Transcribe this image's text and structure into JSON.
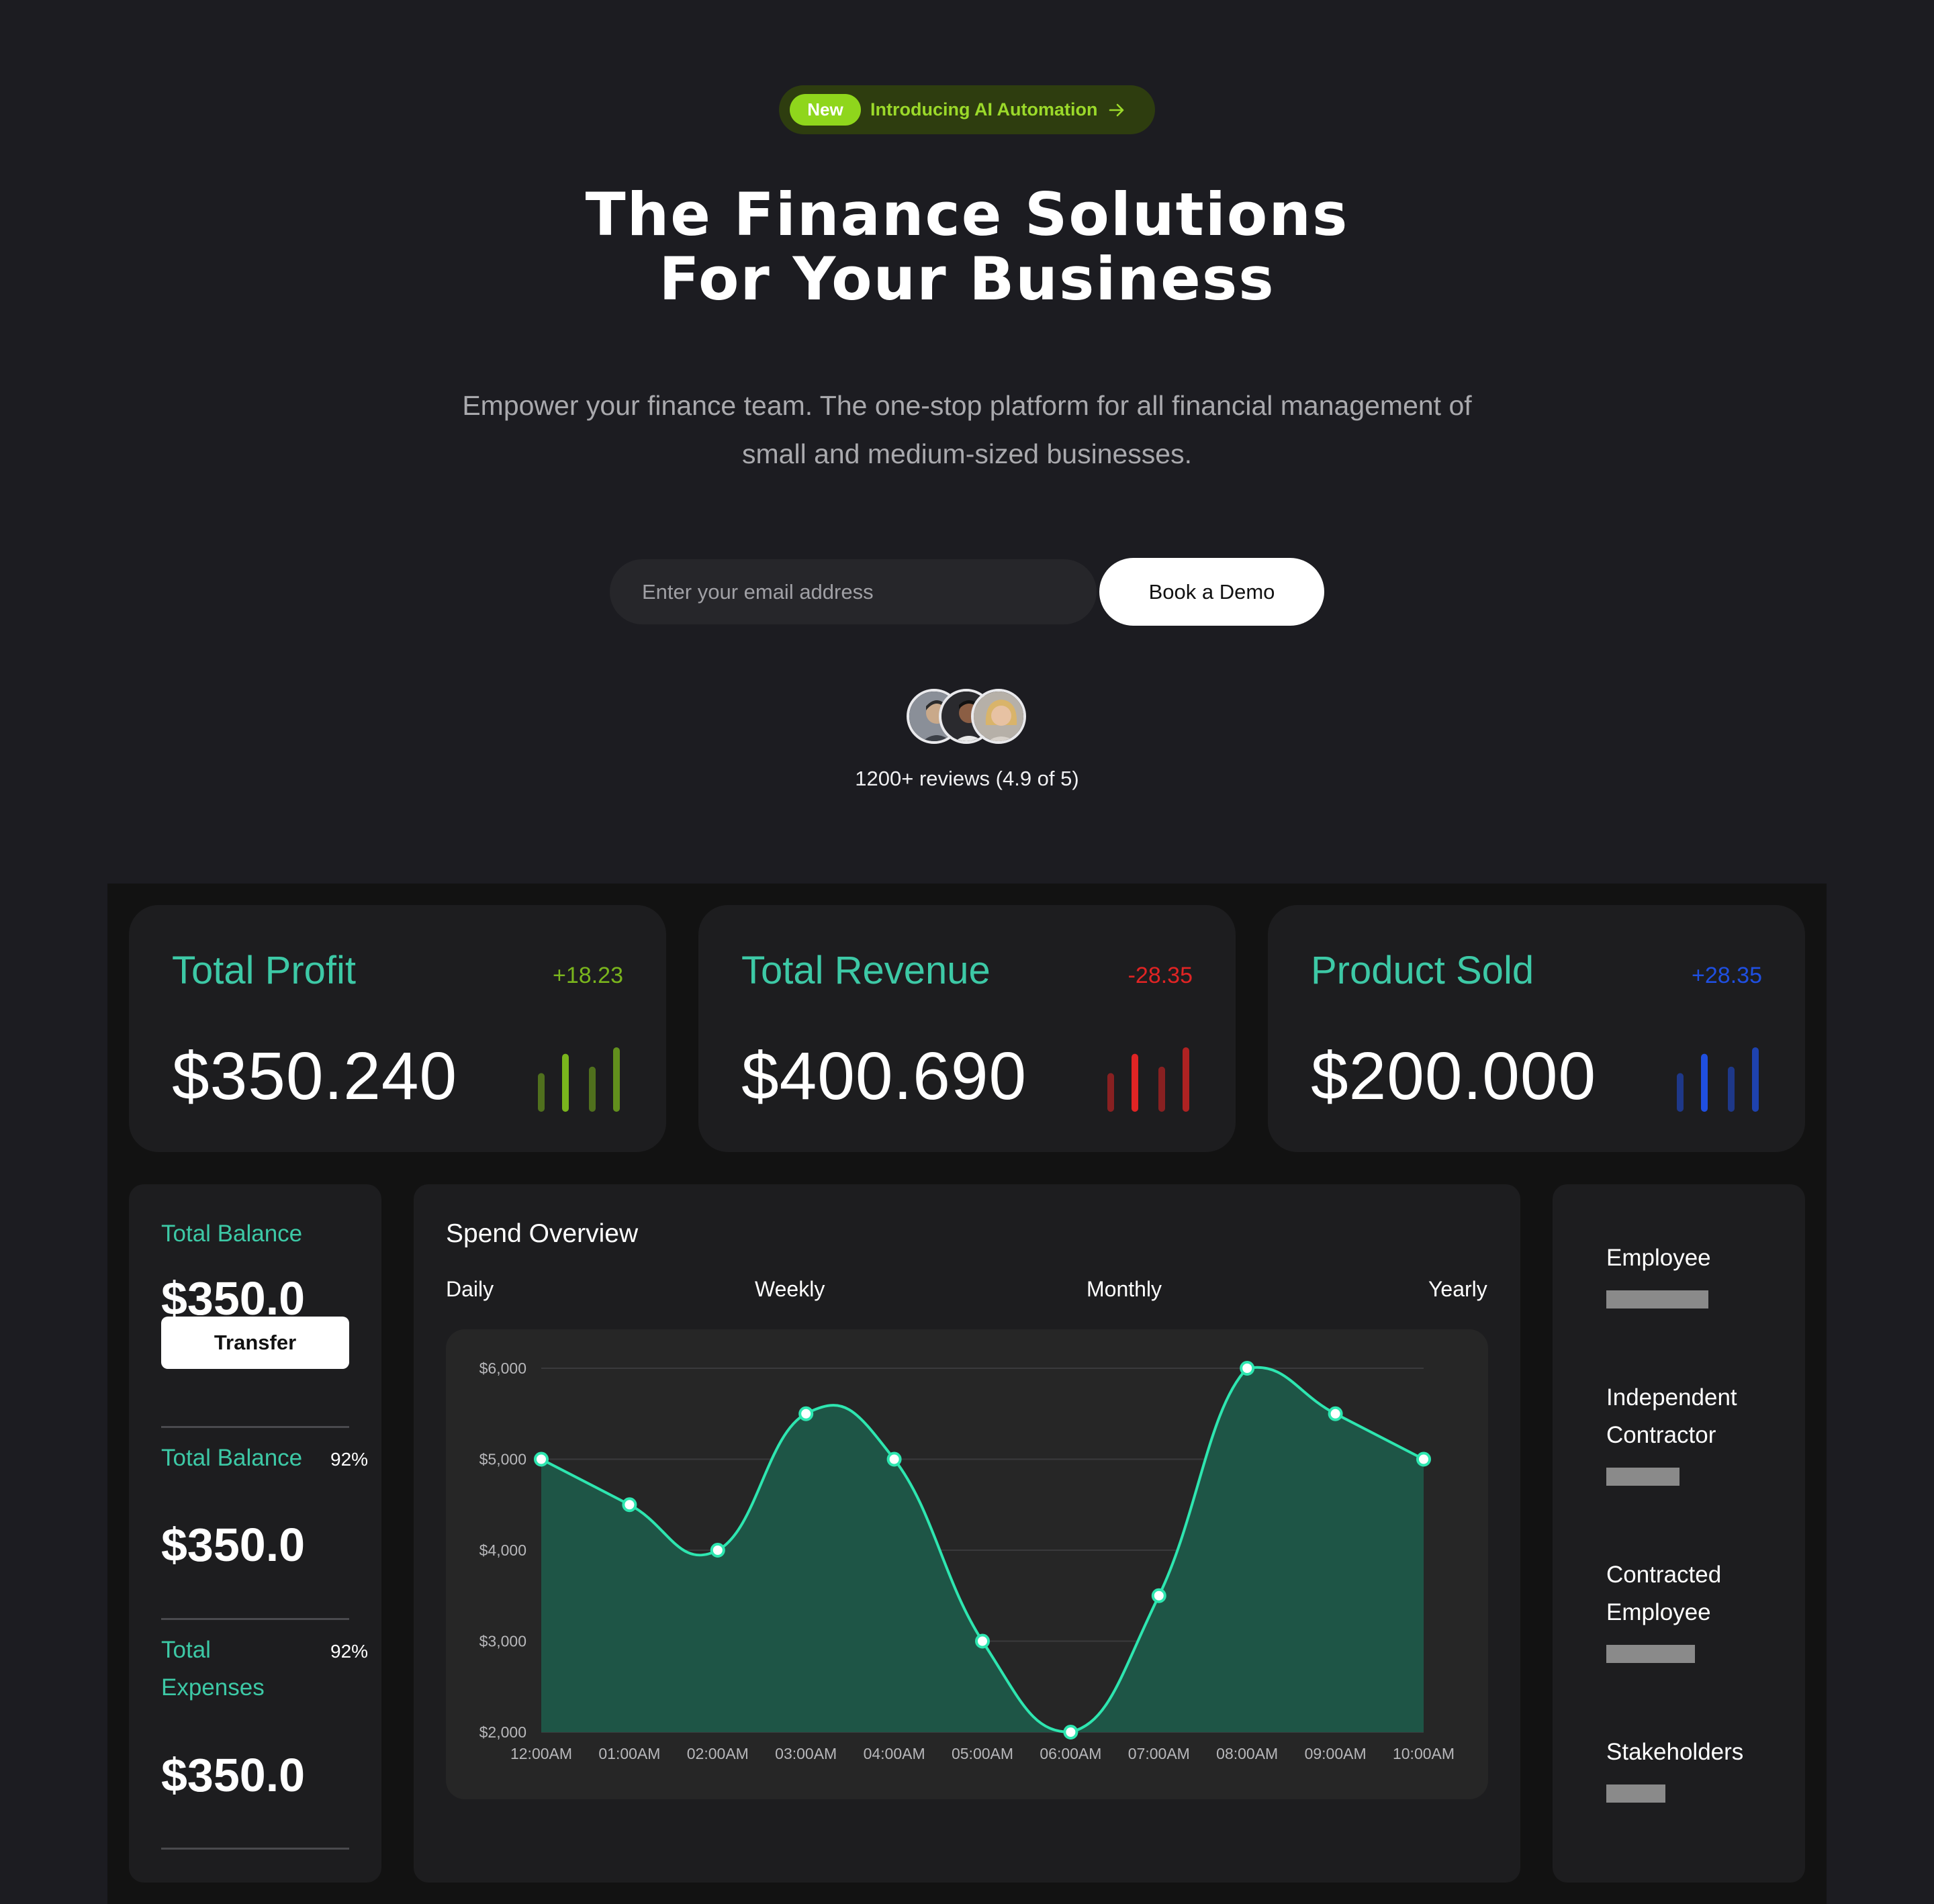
{
  "hero": {
    "badge_new": "New",
    "badge_text": "Introducing AI Automation",
    "title_line1": "The Finance Solutions",
    "title_line2": "For Your Business",
    "subtitle_line1": "Empower your finance team. The one-stop platform for all financial management of",
    "subtitle_line2": "small and medium-sized businesses.",
    "email_placeholder": "Enter your email address",
    "cta_label": "Book a Demo",
    "reviews_text": "1200+ reviews (4.9 of 5)"
  },
  "stats": [
    {
      "title": "Total Profit",
      "change": "+18.23",
      "value": "$350.240",
      "color": "#7ab51d",
      "bars": [
        0.6,
        0.9,
        0.7,
        1.0
      ]
    },
    {
      "title": "Total Revenue",
      "change": "-28.35",
      "value": "$400.690",
      "color": "#e02424",
      "bars": [
        0.6,
        0.9,
        0.7,
        1.0
      ]
    },
    {
      "title": "Product Sold",
      "change": "+28.35",
      "value": "$200.000",
      "color": "#1f4fe0",
      "bars": [
        0.6,
        0.9,
        0.7,
        1.0
      ]
    }
  ],
  "balance": {
    "label1": "Total Balance",
    "value1": "$350.0",
    "transfer_label": "Transfer",
    "label2": "Total Balance",
    "pct2": "92%",
    "value2": "$350.0",
    "label3a": "Total",
    "label3b": "Expenses",
    "pct3": "92%",
    "value3": "$350.0"
  },
  "spend": {
    "title": "Spend Overview",
    "tabs": [
      "Daily",
      "Weekly",
      "Monthly",
      "Yearly"
    ]
  },
  "chart_data": {
    "type": "area",
    "title": "",
    "xlabel": "",
    "ylabel": "",
    "x": [
      "12:00AM",
      "01:00AM",
      "02:00AM",
      "03:00AM",
      "04:00AM",
      "05:00AM",
      "06:00AM",
      "07:00AM",
      "08:00AM",
      "09:00AM",
      "10:00AM"
    ],
    "y_ticks": [
      "$2,000",
      "$3,000",
      "$4,000",
      "$5,000",
      "$6,000"
    ],
    "ylim": [
      2000,
      6000
    ],
    "values": [
      5000,
      4500,
      4000,
      5500,
      5000,
      3000,
      2000,
      3500,
      6000,
      5500,
      5000
    ],
    "grid": true,
    "line_color": "#2ee6b0",
    "fill_color": "#1e5546"
  },
  "people": [
    {
      "label_lines": [
        "Employee"
      ],
      "fraction": 1.0
    },
    {
      "label_lines": [
        "Independent",
        "Contractor"
      ],
      "fraction": 0.72
    },
    {
      "label_lines": [
        "Contracted",
        "Employee"
      ],
      "fraction": 0.87
    },
    {
      "label_lines": [
        "Stakeholders"
      ],
      "fraction": 0.58
    }
  ],
  "colors": {
    "accent_green": "#3dc9a6",
    "badge_green": "#8fd61c",
    "background": "#1c1c21"
  }
}
